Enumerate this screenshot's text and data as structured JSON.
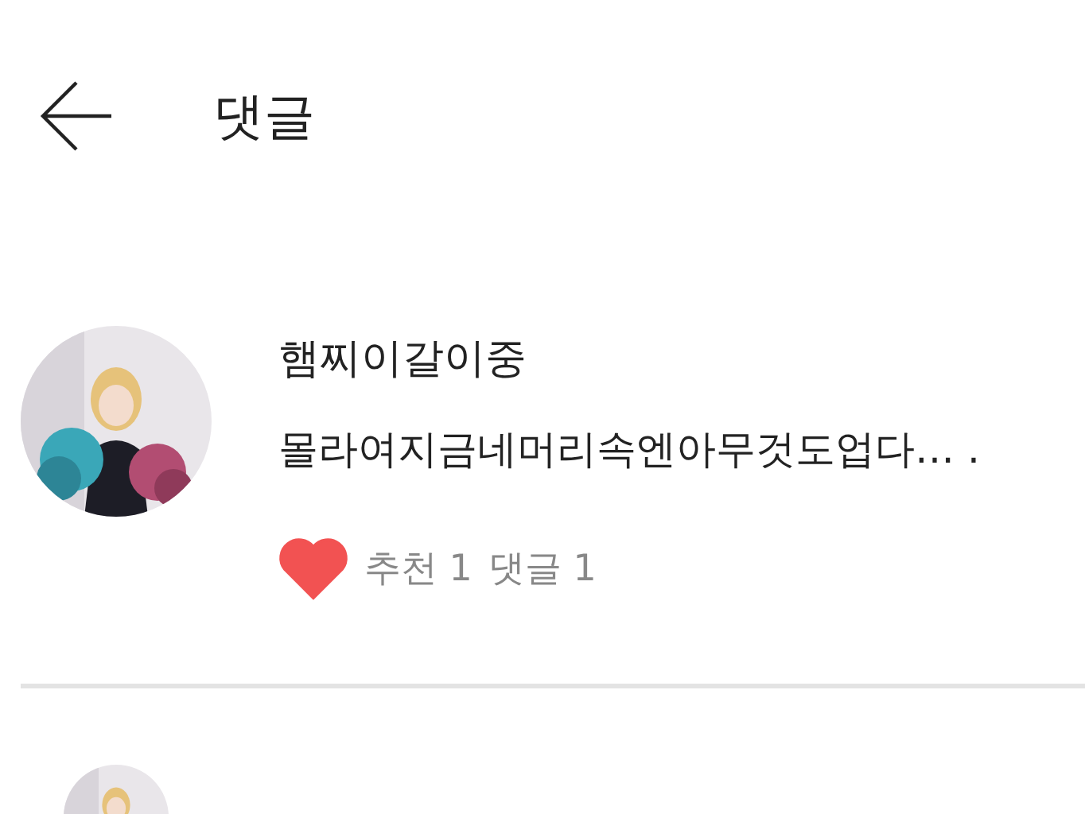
{
  "header": {
    "title": "댓글"
  },
  "comments": [
    {
      "avatar": {
        "kind": "picture"
      },
      "author": "햄찌이갈이중",
      "text": "몰라여지금네머리속엔아무것도업다… .",
      "liked": true,
      "like_label": "추천 1",
      "reply_label": "댓글 1"
    },
    {
      "avatar": {
        "kind": "picture"
      }
    }
  ]
}
